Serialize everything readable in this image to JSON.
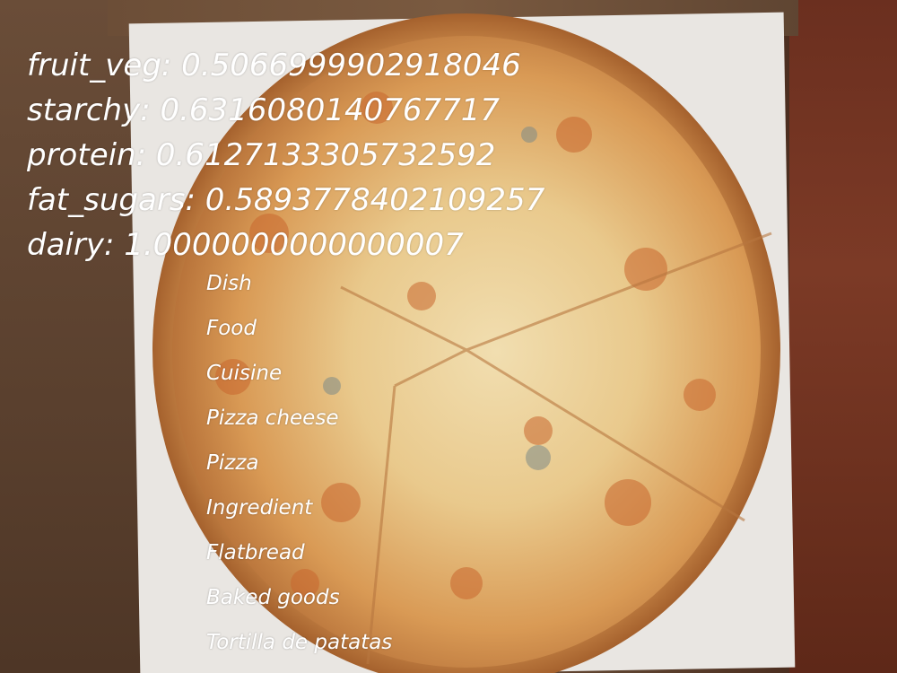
{
  "scores": [
    {
      "text": "fruit_veg: 0.5066999902918046"
    },
    {
      "text": "starchy: 0.6316080140767717"
    },
    {
      "text": "protein: 0.6127133305732592"
    },
    {
      "text": "fat_sugars: 0.5893778402109257"
    },
    {
      "text": "dairy: 1.0000000000000007"
    }
  ],
  "labels": [
    "Dish",
    "Food",
    "Cuisine",
    "Pizza cheese",
    "Pizza",
    "Ingredient",
    "Flatbread",
    "Baked goods",
    "Tortilla de patatas"
  ],
  "colors": {
    "text": "#ffffff",
    "cheese": "#e8c98a",
    "crust": "#c98b4a",
    "box": "#6a4d38"
  }
}
